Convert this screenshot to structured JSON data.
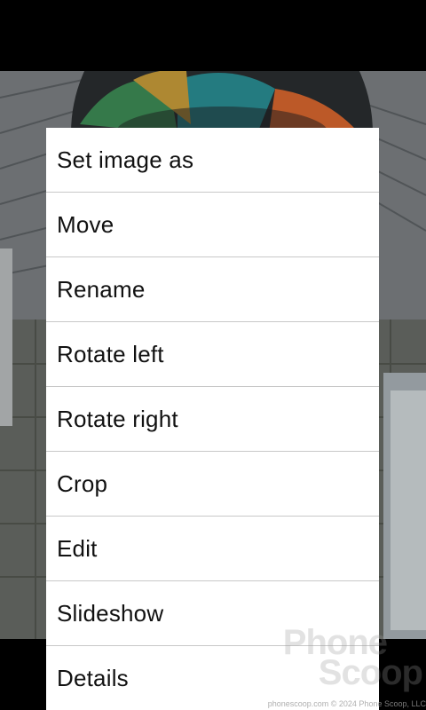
{
  "menu": {
    "items": [
      {
        "label": "Set image as"
      },
      {
        "label": "Move"
      },
      {
        "label": "Rename"
      },
      {
        "label": "Rotate left"
      },
      {
        "label": "Rotate right"
      },
      {
        "label": "Crop"
      },
      {
        "label": "Edit"
      },
      {
        "label": "Slideshow"
      },
      {
        "label": "Details"
      }
    ]
  },
  "watermark": {
    "line1": "Phone",
    "line2": "Scoop",
    "footer": "phonescoop.com  © 2024 Phone Scoop, LLC"
  }
}
